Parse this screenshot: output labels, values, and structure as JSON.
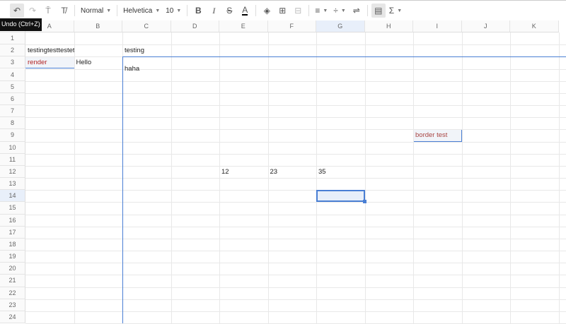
{
  "toolbar": {
    "undo": "undo-icon",
    "redo": "redo-icon",
    "paint_format": "paint-format-icon",
    "clear_format": "clear-format-icon",
    "style": "Normal",
    "font": "Helvetica",
    "font_size": "10",
    "bold": "B",
    "italic": "I",
    "strike": "S",
    "text_color": "A",
    "sum": "Σ"
  },
  "tooltip": "Undo (Ctrl+Z)",
  "columns": [
    "A",
    "B",
    "C",
    "D",
    "E",
    "F",
    "G",
    "H",
    "I",
    "J",
    "K"
  ],
  "rows": [
    "1",
    "2",
    "3",
    "4",
    "5",
    "6",
    "7",
    "8",
    "9",
    "10",
    "11",
    "12",
    "13",
    "14",
    "15",
    "16",
    "17",
    "18",
    "19",
    "20",
    "21",
    "22",
    "23",
    "24"
  ],
  "cells": {
    "A2": "testingtesttestets",
    "C2": "testing",
    "A3": "render",
    "B3": "Hello",
    "C3": "haha",
    "E12": "12",
    "F12": "23",
    "G12": "35",
    "I9": "border test"
  },
  "selection": {
    "cell": "G14",
    "accent": "#4a7fd4"
  },
  "colors": {
    "red_text": "#b22222",
    "border_test_text": "#a94442",
    "selected_fill": "#e8effa"
  }
}
